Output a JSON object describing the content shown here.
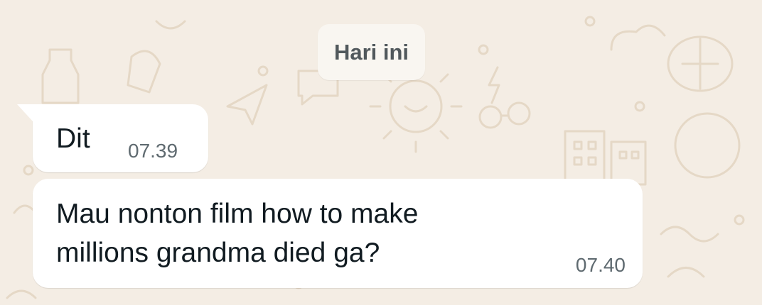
{
  "chat": {
    "date_label": "Hari ini",
    "messages": [
      {
        "text": "Dit",
        "time": "07.39"
      },
      {
        "line1": "Mau nonton film how to make",
        "line2": "millions grandma died ga?",
        "time": "07.40"
      }
    ]
  },
  "colors": {
    "background": "#f4ede4",
    "doodle": "#e5d8c6",
    "bubble": "#ffffff",
    "text": "#111b21",
    "time": "#5f6a70"
  }
}
